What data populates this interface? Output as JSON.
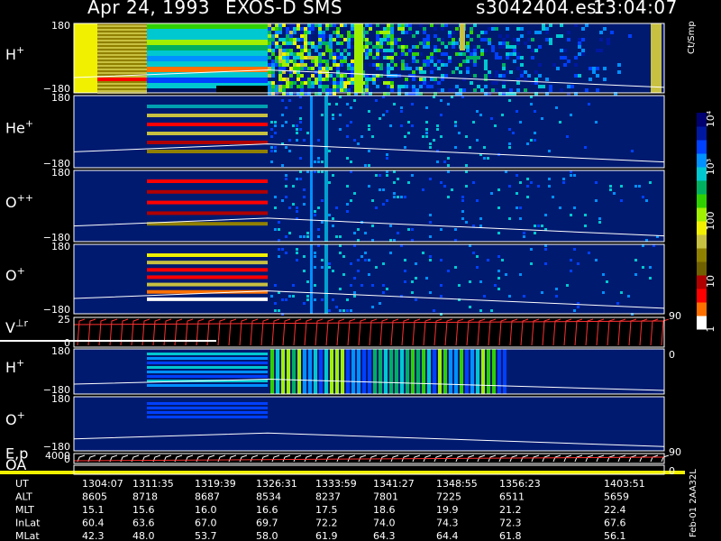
{
  "header": {
    "date": "Apr 24, 1993",
    "instrument": "EXOS-D SMS",
    "file": "s3042404.esr",
    "time": "13:04:07"
  },
  "colorbar": {
    "unit": "Ct/Smp",
    "labels": [
      "1",
      "10",
      "100",
      "10³",
      "10⁴"
    ],
    "colors": [
      "#000070",
      "#0018a0",
      "#0040ff",
      "#0090ff",
      "#00c8d0",
      "#00b060",
      "#30d000",
      "#a0f000",
      "#f0f000",
      "#c8c040",
      "#908000",
      "#706000",
      "#b00000",
      "#ff0000",
      "#ff7000",
      "#ffffff"
    ]
  },
  "side_id": "Feb-01 2AA32L",
  "chart_data": {
    "type": "heatmap",
    "panels": [
      {
        "ion": "H",
        "charge": "+",
        "yticks": [
          "180",
          "−180"
        ]
      },
      {
        "ion": "He",
        "charge": "+",
        "yticks": [
          "180",
          "−180"
        ]
      },
      {
        "ion": "O",
        "charge": "++",
        "yticks": [
          "180",
          "−180"
        ]
      },
      {
        "ion": "O",
        "charge": "+",
        "yticks": [
          "180",
          "−180"
        ]
      },
      {
        "ion": "V",
        "charge": "⊥r",
        "yticks": [
          "25",
          "0"
        ],
        "right_ticks": [
          "90",
          "0"
        ]
      },
      {
        "ion": "H",
        "charge": "+",
        "yticks": [
          "180",
          "−180"
        ]
      },
      {
        "ion": "O",
        "charge": "+",
        "yticks": [
          "180",
          "−180"
        ]
      },
      {
        "ion": "E,p",
        "charge": "",
        "yticks": [
          "4000",
          "0"
        ],
        "right_ticks": [
          "90",
          "0"
        ]
      },
      {
        "ion": "OA",
        "charge": "",
        "yticks": [],
        "right_ticks": []
      }
    ],
    "x_axis": {
      "rows": [
        {
          "label": "UT",
          "values": [
            "1304:07",
            "1311:35",
            "1319:39",
            "1326:31",
            "1333:59",
            "1341:27",
            "1348:55",
            "1356:23",
            "1403:51"
          ]
        },
        {
          "label": "ALT",
          "values": [
            "8605",
            "8718",
            "8687",
            "8534",
            "8237",
            "7801",
            "7225",
            "6511",
            "5659"
          ]
        },
        {
          "label": "MLT",
          "values": [
            "15.1",
            "15.6",
            "16.0",
            "16.6",
            "17.5",
            "18.6",
            "19.9",
            "21.2",
            "22.4"
          ]
        },
        {
          "label": "InLat",
          "values": [
            "60.4",
            "63.6",
            "67.0",
            "69.7",
            "72.2",
            "74.0",
            "74.3",
            "72.3",
            "67.6"
          ]
        },
        {
          "label": "MLat",
          "values": [
            "42.3",
            "48.0",
            "53.7",
            "58.0",
            "61.9",
            "64.3",
            "64.4",
            "61.8",
            "56.1"
          ]
        }
      ]
    },
    "colorbar_range": [
      1,
      10000
    ],
    "colorbar_scale": "log"
  }
}
